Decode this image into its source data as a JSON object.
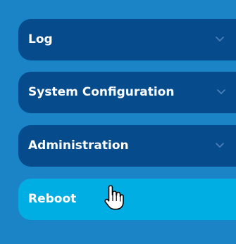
{
  "sidebar": {
    "items": [
      {
        "label": "Log",
        "icon": "chevron-down-icon",
        "active": false
      },
      {
        "label": "System Configuration",
        "icon": "chevron-down-icon",
        "active": false
      },
      {
        "label": "Administration",
        "icon": "chevron-down-icon",
        "active": false
      },
      {
        "label": "Reboot",
        "active": true
      }
    ]
  },
  "colors": {
    "background": "#1b84c6",
    "item": "#064b8c",
    "active_item": "#00aee3",
    "text": "#ffffff",
    "chevron": "#4a7fb8"
  },
  "cursor_icon": "hand-pointer-icon"
}
